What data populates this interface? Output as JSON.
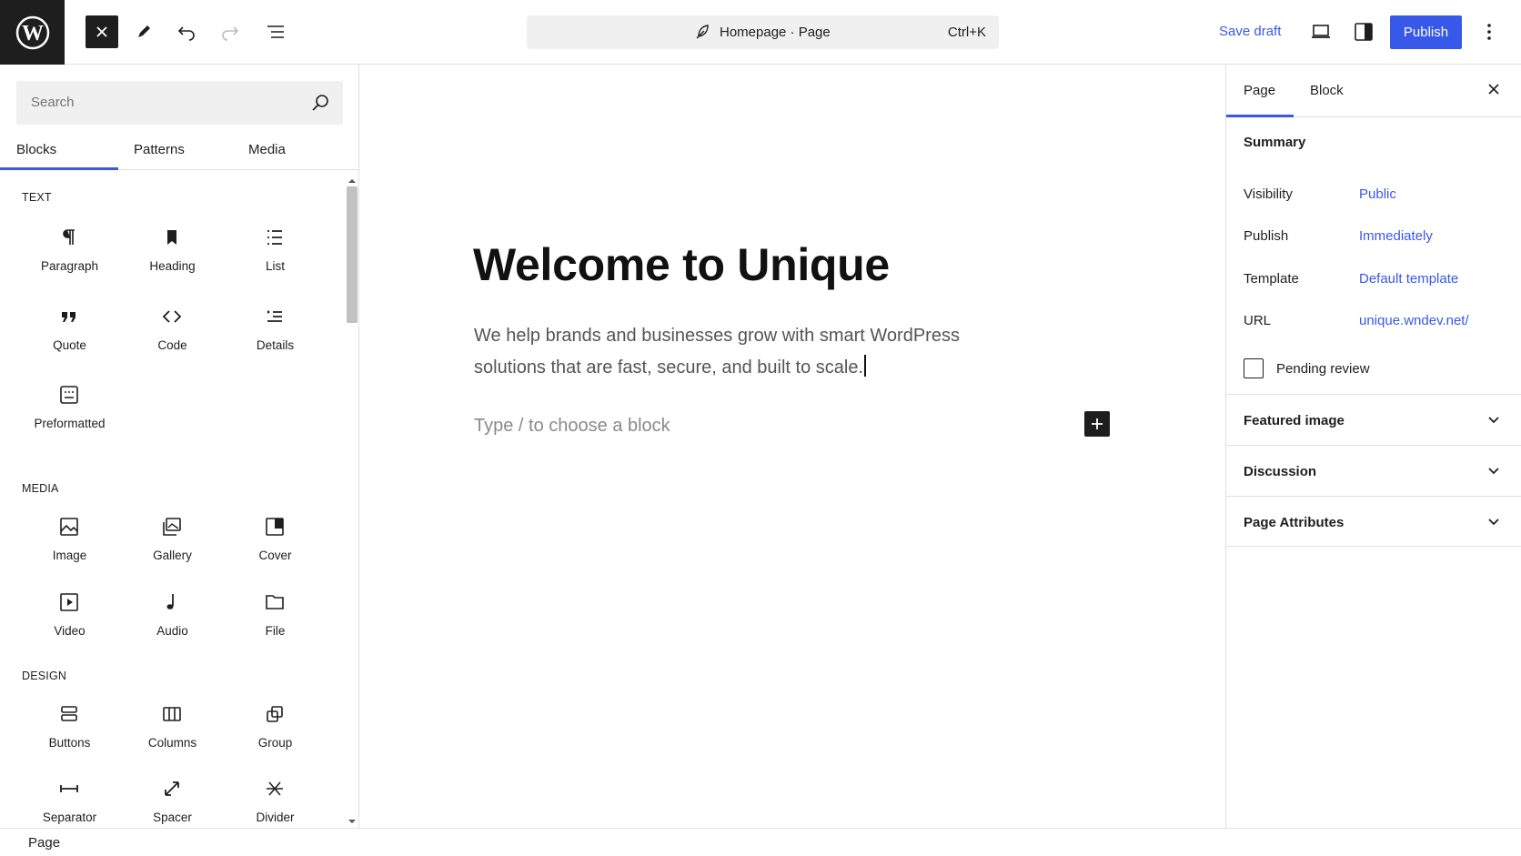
{
  "header": {
    "document_title": "Homepage · Page",
    "shortcut": "Ctrl+K",
    "save_draft_label": "Save draft",
    "publish_label": "Publish",
    "accent_color": "#3858e9"
  },
  "inserter": {
    "search_placeholder": "Search",
    "tabs": [
      {
        "label": "Blocks",
        "active": true
      },
      {
        "label": "Patterns",
        "active": false
      },
      {
        "label": "Media",
        "active": false
      }
    ],
    "categories": [
      {
        "title": "TEXT",
        "blocks": [
          {
            "label": "Paragraph",
            "icon": "paragraph-icon"
          },
          {
            "label": "Heading",
            "icon": "heading-icon"
          },
          {
            "label": "List",
            "icon": "list-icon"
          },
          {
            "label": "Quote",
            "icon": "quote-icon"
          },
          {
            "label": "Code",
            "icon": "code-icon"
          },
          {
            "label": "Details",
            "icon": "details-icon"
          },
          {
            "label": "Preformatted",
            "icon": "preformatted-icon"
          }
        ]
      },
      {
        "title": "MEDIA",
        "blocks": [
          {
            "label": "Image",
            "icon": "image-icon"
          },
          {
            "label": "Gallery",
            "icon": "gallery-icon"
          },
          {
            "label": "Cover",
            "icon": "cover-icon"
          },
          {
            "label": "Video",
            "icon": "video-icon"
          },
          {
            "label": "Audio",
            "icon": "audio-icon"
          },
          {
            "label": "File",
            "icon": "file-icon"
          }
        ]
      },
      {
        "title": "DESIGN",
        "blocks": [
          {
            "label": "Buttons",
            "icon": "buttons-icon"
          },
          {
            "label": "Columns",
            "icon": "columns-icon"
          },
          {
            "label": "Group",
            "icon": "group-icon"
          },
          {
            "label": "Separator",
            "icon": "separator-icon"
          },
          {
            "label": "Spacer",
            "icon": "spacer-icon"
          },
          {
            "label": "Divider",
            "icon": "divider-icon"
          }
        ]
      }
    ]
  },
  "canvas": {
    "title": "Welcome to Unique",
    "paragraph_line1": "We help brands and businesses grow with smart WordPress",
    "paragraph_line2": "solutions that are fast, secure, and built to scale.",
    "block_placeholder": "Type / to choose a block"
  },
  "settings": {
    "tabs": [
      {
        "label": "Page",
        "active": true
      },
      {
        "label": "Block",
        "active": false
      }
    ],
    "summary_title": "Summary",
    "rows": [
      {
        "label": "Visibility",
        "value": "Public"
      },
      {
        "label": "Publish",
        "value": "Immediately"
      },
      {
        "label": "Template",
        "value": "Default template"
      },
      {
        "label": "URL",
        "value": "unique.wndev.net/"
      }
    ],
    "pending_review_label": "Pending review",
    "panels": [
      {
        "title": "Featured image"
      },
      {
        "title": "Discussion"
      },
      {
        "title": "Page Attributes"
      }
    ]
  },
  "footer": {
    "breadcrumb": "Page"
  }
}
